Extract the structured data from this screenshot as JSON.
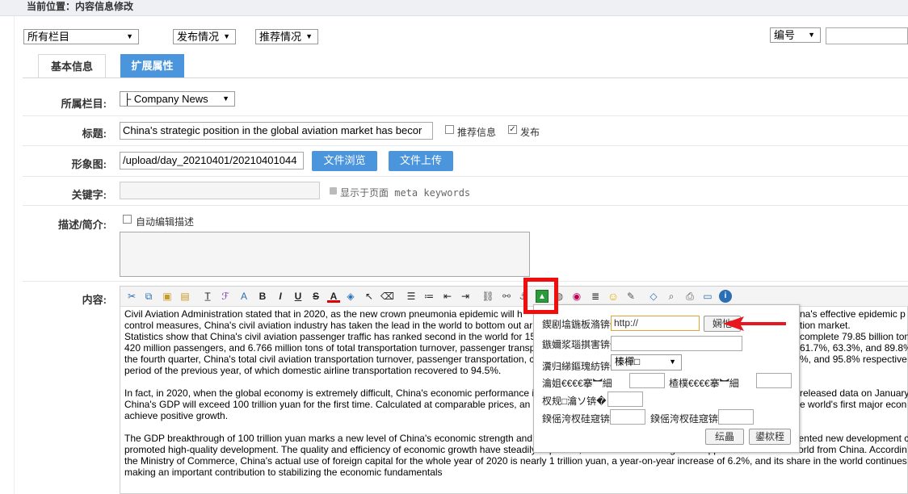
{
  "breadcrumb": "当前位置：内容信息修改",
  "filters": {
    "column": "所有栏目",
    "publish": "发布情况",
    "recommend": "推荐情况",
    "id_field": "编号",
    "search_value": ""
  },
  "tabs": {
    "basic": "基本信息",
    "extended": "扩展属性"
  },
  "form": {
    "column_label": "所属栏目:",
    "column_value": "├ Company News",
    "title_label": "标题:",
    "title_value": "China's strategic position in the global aviation market has becor",
    "recommend_label": "推荐信息",
    "publish_label": "发布",
    "image_label": "形象图:",
    "image_value": "/upload/day_20210401/20210401044",
    "browse_button": "文件浏览",
    "upload_button": "文件上传",
    "keywords_label": "关键字:",
    "keywords_value": "",
    "keywords_hint": "显示于页面 meta keywords",
    "desc_label": "描述/简介:",
    "auto_desc_label": "自动编辑描述",
    "content_label": "内容:"
  },
  "content_lines": [
    "Civil Aviation Administration stated that in 2020, as the new crown pneumonia epidemic will h",
    "control measures, China's civil aviation industry has taken the lead in the world to bottom out ar",
    "Statistics show that China's civil aviation passenger traffic has ranked second in the world for 15",
    "420 million passengers, and 6.766 million tons of total transportation turnover, passenger transp",
    "the fourth quarter, China's total civil aviation transportation turnover, passenger transportation, c",
    "period of the previous year, of which domestic airline transportation recovered to 94.5%.",
    "",
    "In fact, in 2020, when the global economy is extremely difficult, China's economic performance i",
    "China's GDP will exceed 100 trillion yuan for the first time. Calculated at comparable prices, an",
    "achieve positive growth.",
    "",
    "The GDP breakthrough of 100 trillion yuan marks a new level of China's economic strength and overall national strength. At the same time, China has implemented new development c",
    "promoted high-quality development. The quality and efficiency of economic growth have steadily improved, and it is also creating more opportunities for the world from China. Accordin",
    "the Ministry of Commerce, China's actual use of foreign capital for the whole year of 2020 is nearly 1 trillion yuan, a year-on-year increase of 6.2%, and its share in the world continues",
    "making an important contribution to stabilizing the economic fundamentals"
  ],
  "content_right_lines": [
    "na's effective epidemic p",
    "tion market.",
    "complete 79.85 billion ton",
    "61.7%, 63.3%, and 89.8%",
    "%, and 95.8% respective",
    "",
    "",
    "released data on January",
    "e world's first major econ"
  ],
  "dialog": {
    "url_label": "鍥剧墖鍦板潃锛�",
    "url_value": "http://",
    "browse_button": "娴忚",
    "alt_label": "鏃嬭浆瑙掑害锛�",
    "align_label": "瀵归綈鏂瑰紡锛�",
    "align_value": "榛樿□",
    "width_label": "瀹姐€€€€搴︼細",
    "height_label": "楂樸€€€€搴︼細",
    "border_label": "杈规□瀹ソ锛�",
    "hspace_label": "鍨傜洿杈硅窛锛�",
    "vspace_label": "鍨傜洿杈硅窛锛�",
    "ok_button": "纭畾",
    "cancel_button": "鍙栨秷"
  },
  "colors": {
    "accent": "#4b95dd",
    "highlight": "#f20d0d"
  }
}
